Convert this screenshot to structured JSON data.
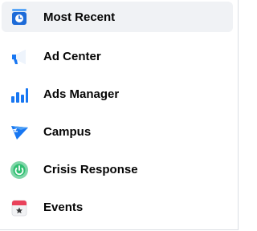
{
  "menu": {
    "items": [
      {
        "label": "Most Recent",
        "icon": "most-recent-clock-icon",
        "selected": true
      },
      {
        "label": "Ad Center",
        "icon": "megaphone-icon",
        "selected": false
      },
      {
        "label": "Ads Manager",
        "icon": "bar-chart-icon",
        "selected": false
      },
      {
        "label": "Campus",
        "icon": "campus-pennant-icon",
        "selected": false
      },
      {
        "label": "Crisis Response",
        "icon": "crisis-response-icon",
        "selected": false
      },
      {
        "label": "Events",
        "icon": "calendar-star-icon",
        "selected": false
      }
    ]
  },
  "colors": {
    "selected_background": "#f0f2f5",
    "text": "#050505",
    "blue": "#1877f2",
    "light_blue": "#4ea0f5",
    "green": "#42b883",
    "red": "#e9425b"
  }
}
